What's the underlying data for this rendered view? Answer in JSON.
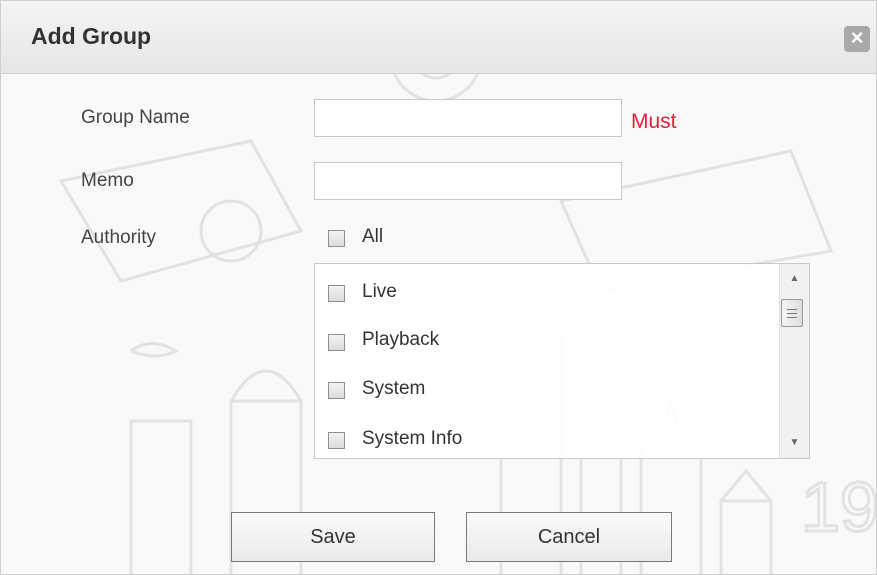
{
  "dialog": {
    "title": "Add Group",
    "close_icon": "close-icon"
  },
  "form": {
    "group_name": {
      "label": "Group Name",
      "value": "",
      "required_text": "Must"
    },
    "memo": {
      "label": "Memo",
      "value": ""
    },
    "authority": {
      "label": "Authority",
      "all_label": "All",
      "all_checked": false,
      "items": [
        {
          "label": "Live",
          "checked": false
        },
        {
          "label": "Playback",
          "checked": false
        },
        {
          "label": "System",
          "checked": false
        },
        {
          "label": "System Info",
          "checked": false
        }
      ]
    }
  },
  "buttons": {
    "save": "Save",
    "cancel": "Cancel"
  },
  "colors": {
    "required": "#e0233a",
    "titlebar": "#e6e6e6"
  }
}
